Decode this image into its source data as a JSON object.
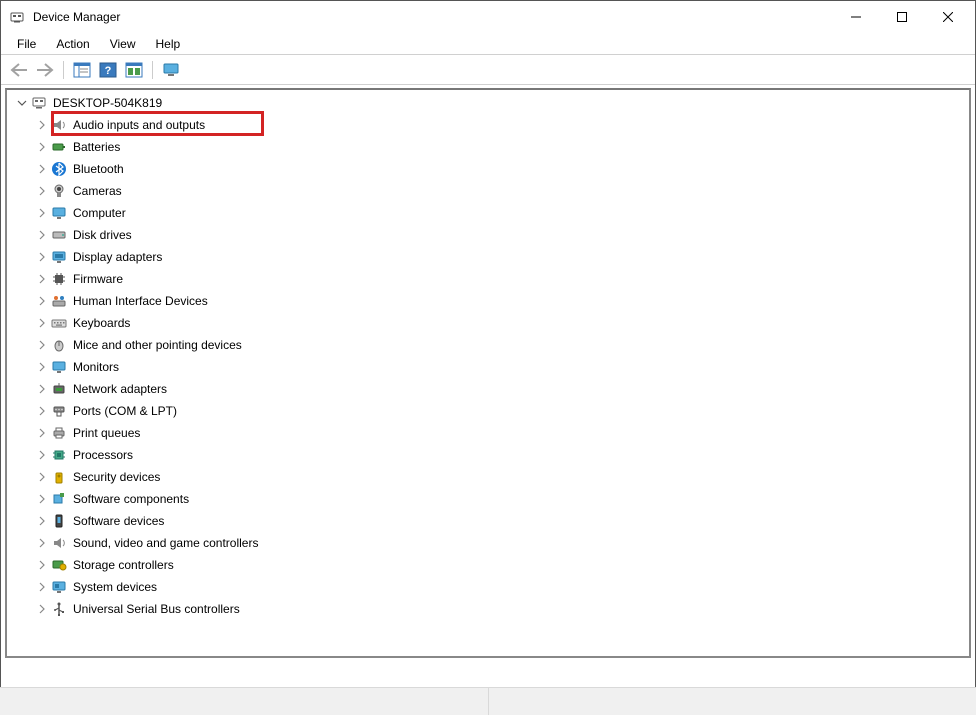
{
  "window": {
    "title": "Device Manager"
  },
  "menu": {
    "file": "File",
    "action": "Action",
    "view": "View",
    "help": "Help"
  },
  "tree": {
    "root": "DESKTOP-504K819",
    "items": [
      "Audio inputs and outputs",
      "Batteries",
      "Bluetooth",
      "Cameras",
      "Computer",
      "Disk drives",
      "Display adapters",
      "Firmware",
      "Human Interface Devices",
      "Keyboards",
      "Mice and other pointing devices",
      "Monitors",
      "Network adapters",
      "Ports (COM & LPT)",
      "Print queues",
      "Processors",
      "Security devices",
      "Software components",
      "Software devices",
      "Sound, video and game controllers",
      "Storage controllers",
      "System devices",
      "Universal Serial Bus controllers"
    ]
  },
  "highlighted_index": 0
}
